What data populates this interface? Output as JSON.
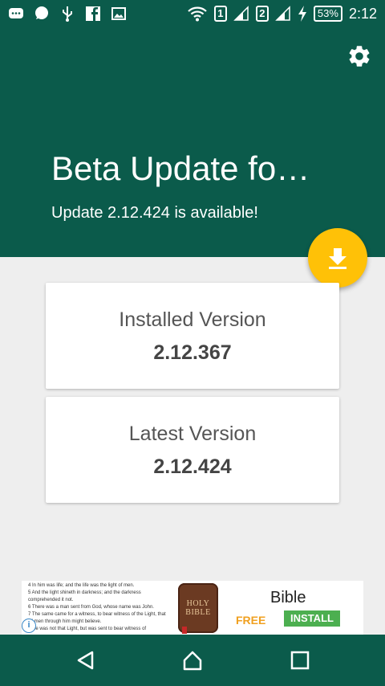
{
  "status_bar": {
    "sim1": "1",
    "sim2": "2",
    "battery": "53%",
    "time": "2:12"
  },
  "header": {
    "title": "Beta Update fo…",
    "subtitle": "Update 2.12.424 is available!"
  },
  "cards": {
    "installed": {
      "label": "Installed Version",
      "value": "2.12.367"
    },
    "latest": {
      "label": "Latest Version",
      "value": "2.12.424"
    }
  },
  "ad": {
    "scripture_lines": [
      "4 In him was life; and the life was the light of men.",
      "5 And the light shineth in darkness; and the darkness comprehended it not.",
      "6 There was a man sent from God, whose name was John.",
      "7 The same came for a witness, to bear witness of the Light, that all men through him might believe.",
      "8 He was not that Light, but was sent to bear witness of"
    ],
    "book_line1": "HOLY",
    "book_line2": "BIBLE",
    "title": "Bible",
    "free_label": "FREE",
    "install_label": "INSTALL",
    "info_glyph": "i"
  },
  "icons": {
    "settings": "gear-icon",
    "fab": "download-icon",
    "nav_back": "back-triangle-icon",
    "nav_home": "home-icon",
    "nav_recents": "recents-square-icon"
  },
  "colors": {
    "primary": "#0b5b4b",
    "accent": "#ffc107",
    "install_green": "#4caf50",
    "free_orange": "#f0a020"
  }
}
